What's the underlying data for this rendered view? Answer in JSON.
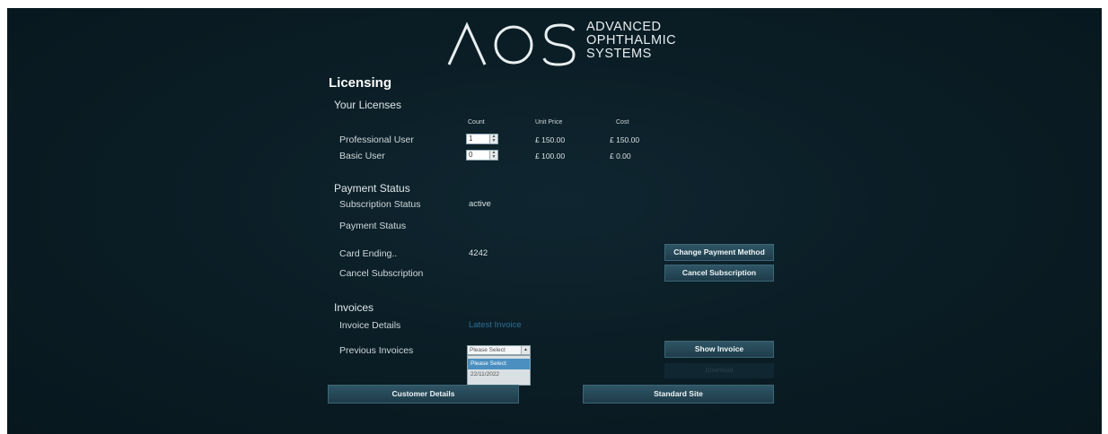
{
  "logo": {
    "mark": "AOS",
    "line1": "ADVANCED",
    "line2": "OPHTHALMIC",
    "line3": "SYSTEMS"
  },
  "page_title": "Licensing",
  "licenses": {
    "heading": "Your Licenses",
    "columns": {
      "count": "Count",
      "unit_price": "Unit Price",
      "cost": "Cost"
    },
    "rows": [
      {
        "label": "Professional User",
        "count": "1",
        "unit_price": "£ 150.00",
        "cost": "£ 150.00"
      },
      {
        "label": "Basic User",
        "count": "0",
        "unit_price": "£ 100.00",
        "cost": "£ 0.00"
      }
    ]
  },
  "payment": {
    "heading": "Payment Status",
    "subscription_status_label": "Subscription Status",
    "subscription_status_value": "active",
    "payment_status_label": "Payment Status",
    "card_ending_label": "Card Ending..",
    "card_ending_value": "4242",
    "cancel_label": "Cancel Subscription",
    "change_payment_button": "Change Payment Method",
    "cancel_button": "Cancel Subscription"
  },
  "invoices": {
    "heading": "Invoices",
    "details_label": "Invoice Details",
    "latest_invoice_link": "Latest Invoice",
    "previous_label": "Previous Invoices",
    "select_value": "Please Select",
    "options": [
      "Please Select",
      "22/11/2022"
    ],
    "show_button": "Show Invoice",
    "ghost_button": "Download"
  },
  "footer": {
    "customer_details_button": "Customer Details",
    "standard_site_button": "Standard Site"
  },
  "colors": {
    "background": "#0a1c24",
    "button": "#2a4c5c",
    "link": "#2c6f95",
    "selected_option": "#4a8fc0"
  }
}
